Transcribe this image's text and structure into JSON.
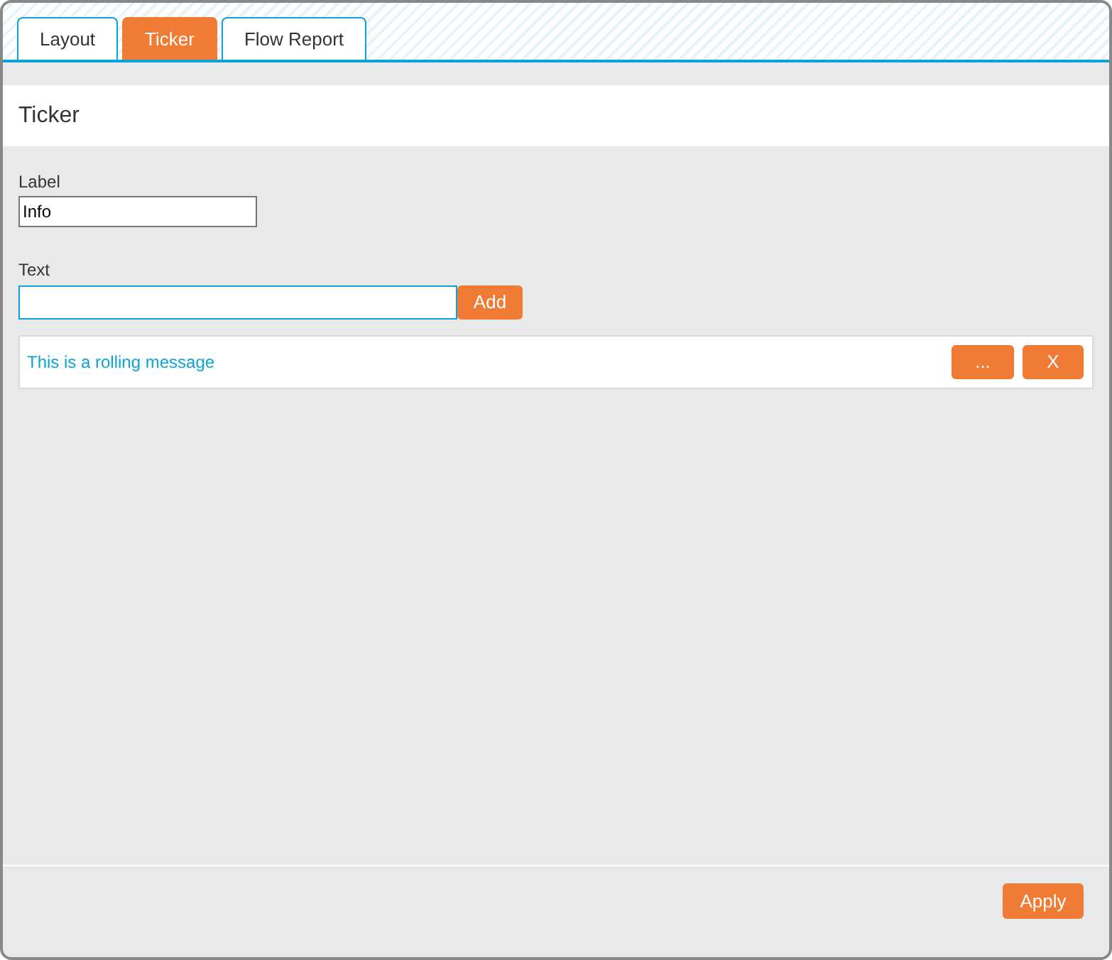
{
  "tabs": [
    {
      "label": "Layout",
      "selected": false
    },
    {
      "label": "Ticker",
      "selected": true
    },
    {
      "label": "Flow Report",
      "selected": false
    }
  ],
  "panel": {
    "title": "Ticker"
  },
  "label_field": {
    "label": "Label",
    "value": "Info"
  },
  "text_field": {
    "label": "Text",
    "button": "Add"
  },
  "messages": [
    {
      "text": "This is a rolling message",
      "edit_button": "...",
      "delete_button": "X"
    }
  ],
  "footer": {
    "button": "Apply"
  }
}
